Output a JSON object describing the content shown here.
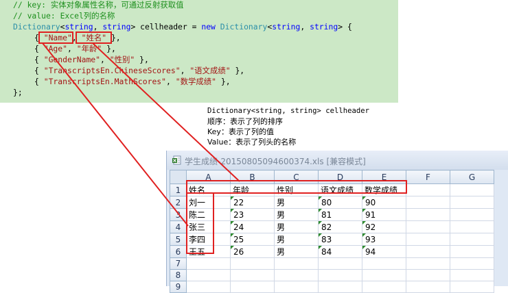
{
  "code": {
    "comment1": "// key: 实体对象属性名称，可通过反射获取值",
    "comment2": "// value: Excel列的名称",
    "decl_type": "Dictionary",
    "decl_generic_open": "<",
    "decl_t1": "string",
    "decl_comma": ", ",
    "decl_t2": "string",
    "decl_generic_close": ">",
    "decl_name": " cellheader = ",
    "decl_new": "new",
    "decl_type2": " Dictionary",
    "decl_end": "> {",
    "entries": [
      {
        "key": "\"Name\"",
        "value": "\"姓名\""
      },
      {
        "key": "\"Age\"",
        "value": "\"年龄\""
      },
      {
        "key": "\"GenderName\"",
        "value": "\"性别\""
      },
      {
        "key": "\"TranscriptsEn.ChineseScores\"",
        "value": "\"语文成绩\""
      },
      {
        "key": "\"TranscriptsEn.MathScores\"",
        "value": "\"数学成绩\""
      }
    ],
    "closing": "};"
  },
  "notes": {
    "line1": "Dictionary<string, string> cellheader",
    "line2": "顺序：表示了列的排序",
    "line3": "Key：表示了列的值",
    "line4": "Value：表示了列头的名称"
  },
  "excel": {
    "title": "学生成绩-20150805094600374.xls  [兼容模式]",
    "icon": "excel-file-icon",
    "columns": [
      "A",
      "B",
      "C",
      "D",
      "E",
      "F",
      "G"
    ],
    "row_numbers": [
      "1",
      "2",
      "3",
      "4",
      "5",
      "6",
      "7",
      "8",
      "9"
    ],
    "header_row": [
      "姓名",
      "年龄",
      "性别",
      "语文成绩",
      "数学成绩",
      "",
      ""
    ],
    "rows": [
      [
        "刘一",
        "22",
        "男",
        "80",
        "90"
      ],
      [
        "陈二",
        "23",
        "男",
        "81",
        "91"
      ],
      [
        "张三",
        "24",
        "男",
        "82",
        "92"
      ],
      [
        "李四",
        "25",
        "男",
        "83",
        "93"
      ],
      [
        "王五",
        "26",
        "男",
        "84",
        "94"
      ]
    ],
    "number_indicator_color": "#2e8b2e"
  },
  "annotation_color": "#e02020"
}
